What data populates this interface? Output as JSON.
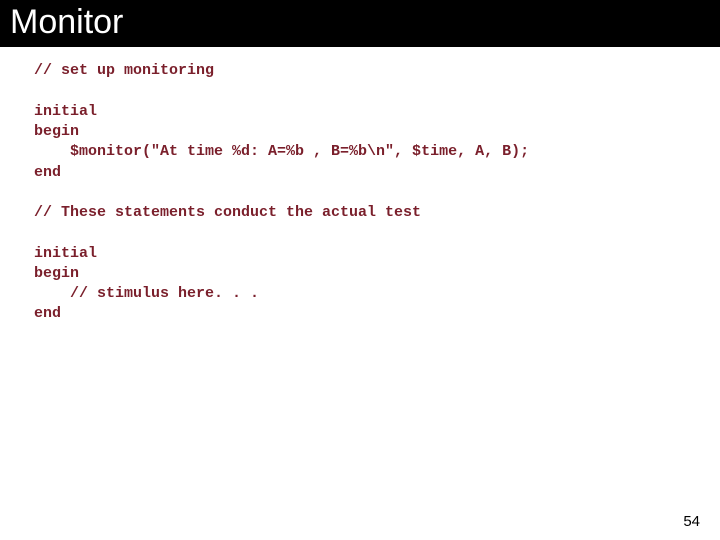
{
  "title": "Monitor",
  "code": "// set up monitoring\n\ninitial\nbegin\n    $monitor(\"At time %d: A=%b , B=%b\\n\", $time, A, B);\nend\n\n// These statements conduct the actual test\n\ninitial\nbegin\n    // stimulus here. . .\nend",
  "page_number": "54"
}
